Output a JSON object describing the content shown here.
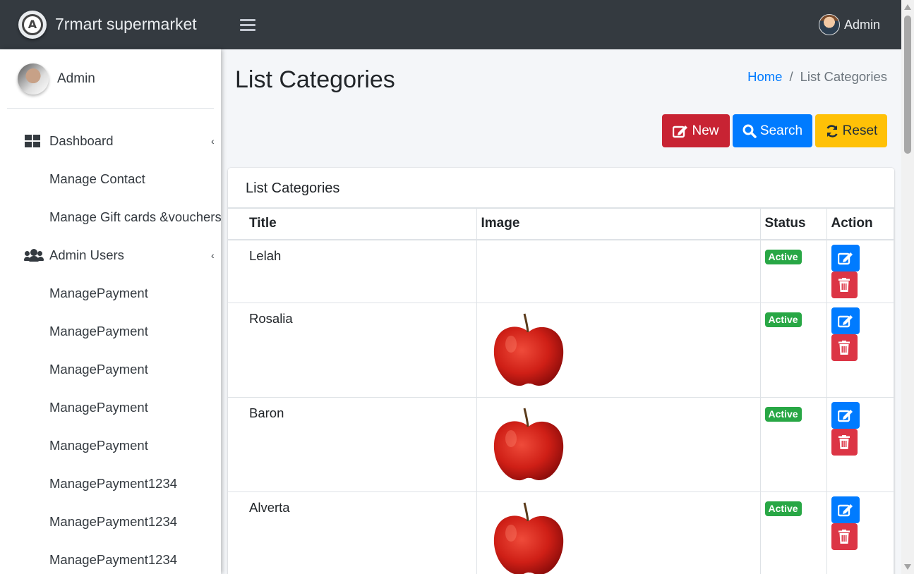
{
  "brand": {
    "name": "7rmart supermarket",
    "logo_letter": "A"
  },
  "topbar": {
    "user_name": "Admin"
  },
  "sidebar": {
    "user_name": "Admin",
    "items": [
      {
        "label": "Dashboard",
        "icon": "dashboard-icon",
        "has_caret": true
      },
      {
        "label": "Manage Contact"
      },
      {
        "label": "Manage Gift cards &vouchers"
      },
      {
        "label": "Admin Users",
        "icon": "users-icon",
        "has_caret": true
      },
      {
        "label": "ManagePayment"
      },
      {
        "label": "ManagePayment"
      },
      {
        "label": "ManagePayment"
      },
      {
        "label": "ManagePayment"
      },
      {
        "label": "ManagePayment"
      },
      {
        "label": "ManagePayment1234"
      },
      {
        "label": "ManagePayment1234"
      },
      {
        "label": "ManagePayment1234"
      }
    ]
  },
  "page": {
    "title": "List Categories",
    "breadcrumb": {
      "home": "Home",
      "separator": "/",
      "current": "List Categories"
    }
  },
  "toolbar": {
    "new_label": "New",
    "search_label": "Search",
    "reset_label": "Reset"
  },
  "card": {
    "title": "List Categories",
    "columns": [
      "Title",
      "Image",
      "Status",
      "Action"
    ],
    "rows": [
      {
        "title": "Lelah",
        "image": "",
        "status": "Active"
      },
      {
        "title": "Rosalia",
        "image": "apple",
        "status": "Active"
      },
      {
        "title": "Baron",
        "image": "apple",
        "status": "Active"
      },
      {
        "title": "Alverta",
        "image": "apple",
        "status": "Active"
      }
    ]
  },
  "colors": {
    "navbar": "#343a40",
    "primary": "#007bff",
    "danger": "#dc3545",
    "new_button": "#c82333",
    "warning": "#ffc107",
    "success": "#28a745"
  }
}
